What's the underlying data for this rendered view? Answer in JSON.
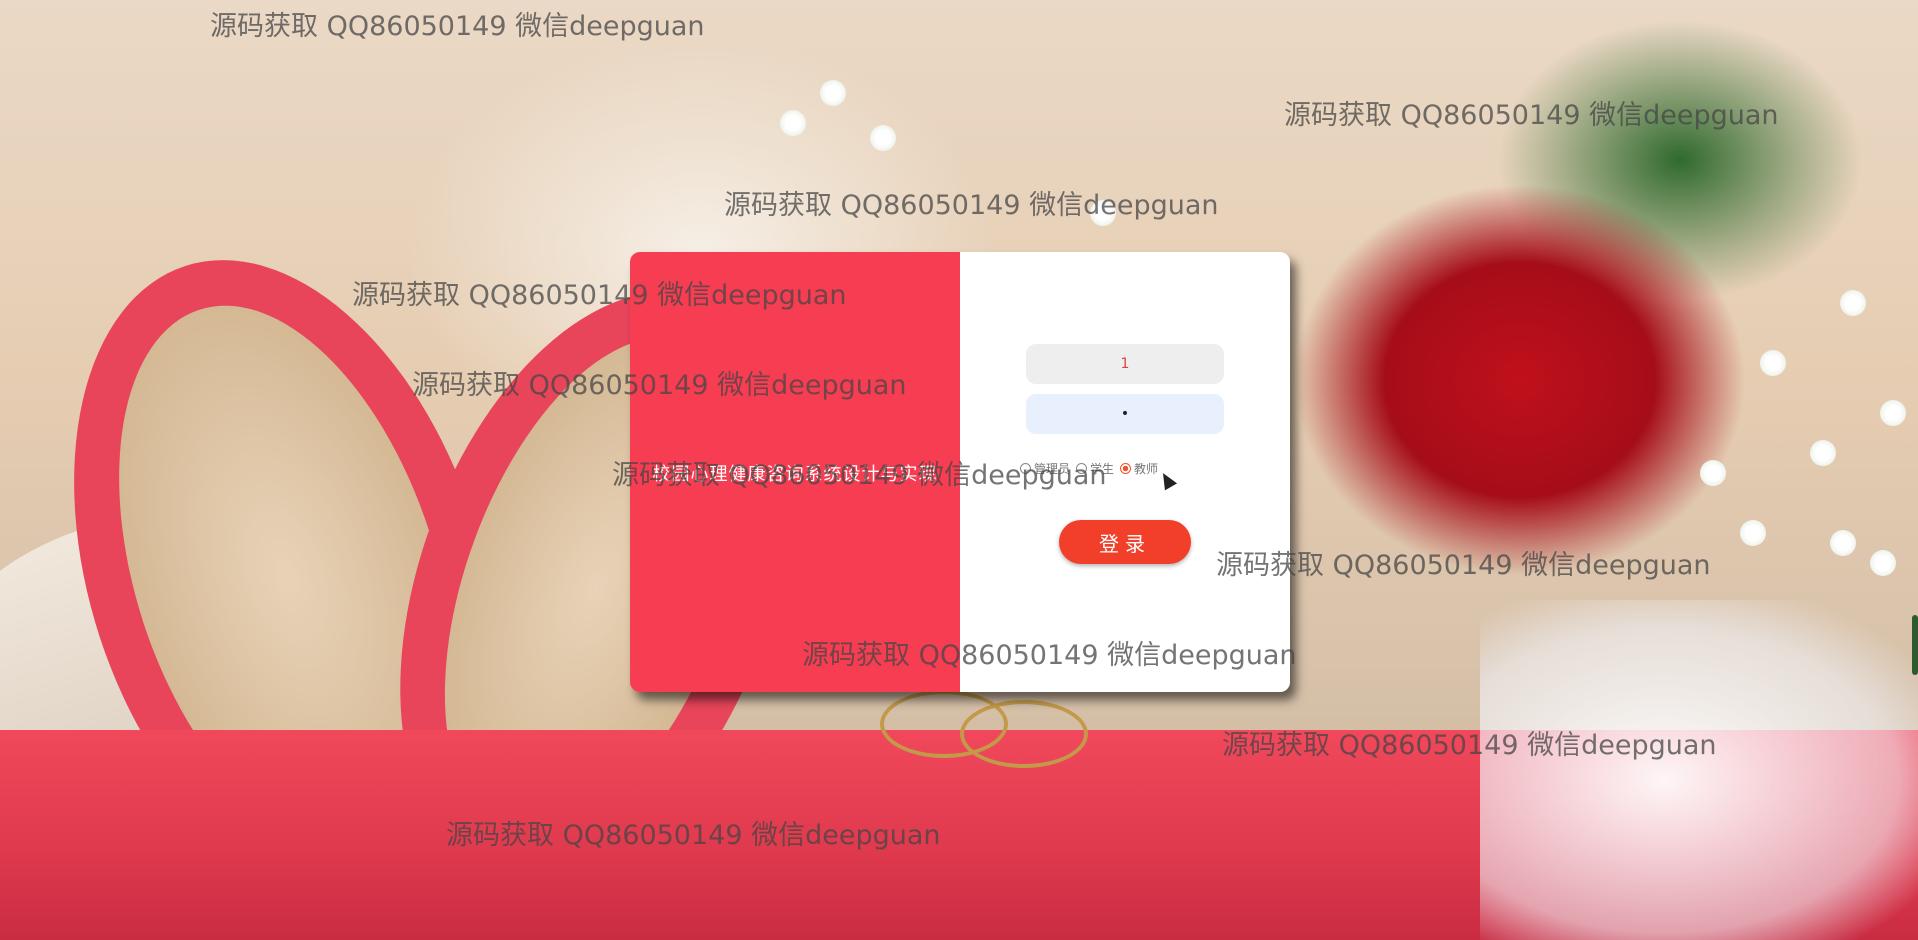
{
  "login": {
    "system_title": "校园心理健康咨询系统设计与实现",
    "username_value": "1",
    "password_value": "•",
    "roles": [
      {
        "label": "管理员",
        "checked": false
      },
      {
        "label": "学生",
        "checked": false
      },
      {
        "label": "教师",
        "checked": true
      }
    ],
    "login_button": "登录"
  },
  "watermark_text": "源码获取 QQ86050149 微信deepguan",
  "colors": {
    "card_left": "#f63d52",
    "card_right": "#ffffff",
    "login_button": "#f23f2a",
    "watermark": "#464646"
  }
}
